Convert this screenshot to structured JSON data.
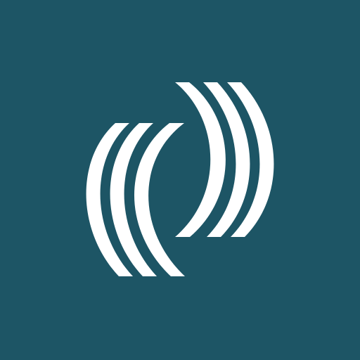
{
  "icon": {
    "name": "concentric-arcs-logo-icon",
    "background_color": "#1d5565",
    "mark_color": "#ffffff"
  }
}
